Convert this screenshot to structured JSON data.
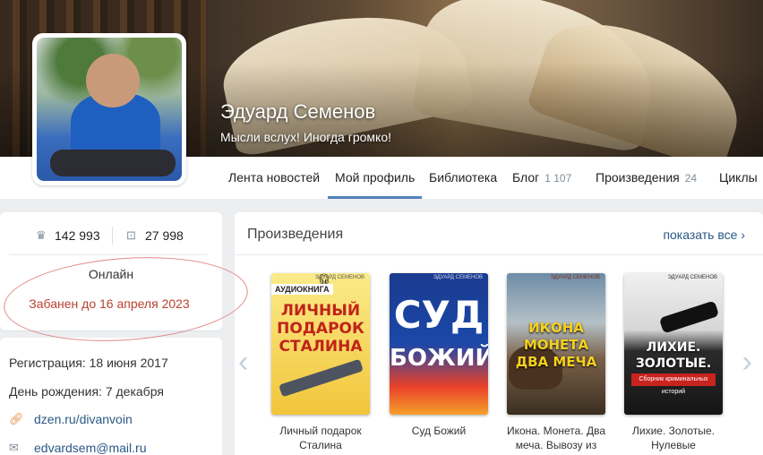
{
  "profile": {
    "name": "Эдуард Семенов",
    "motto": "Мысли вслух! Иногда громко!"
  },
  "nav": {
    "items": [
      {
        "label": "Лента новостей",
        "count": ""
      },
      {
        "label": "Мой профиль",
        "count": "",
        "active": true
      },
      {
        "label": "Библиотека",
        "count": ""
      },
      {
        "label": "Блог",
        "count": "1 107"
      },
      {
        "label": "Произведения",
        "count": "24"
      },
      {
        "label": "Циклы",
        "count": ""
      }
    ]
  },
  "stats": {
    "followers": "142 993",
    "library": "27 998",
    "status": "Онлайн",
    "ban": "Забанен до 16 апреля 2023"
  },
  "info": {
    "registration": "Регистрация: 18 июня 2017",
    "birthday": "День рождения: 7 декабря",
    "site": "dzen.ru/divanvoin",
    "email": "edvardsem@mail.ru"
  },
  "works": {
    "title": "Произведения",
    "show_all": "показать все",
    "books": [
      {
        "label": "Личный подарок Сталина",
        "cover_title": "ЛИЧНЫЙ ПОДАРОК СТАЛИНА",
        "badge": "АУДИОКНИГА"
      },
      {
        "label": "Суд Божий",
        "cover_title_1": "СУД",
        "cover_title_2": "БОЖИЙ"
      },
      {
        "label": "Икона. Монета. Два меча. Вывозу из",
        "cover_title": "ИКОНА МОНЕТА ДВА МЕЧА"
      },
      {
        "label": "Лихие. Золотые. Нулевые",
        "cover_title": "ЛИХИЕ. ЗОЛОТЫЕ. НУЛЕВЫЕ.",
        "cover_sub": "Сборник криминальных историй"
      }
    ],
    "cover_author": "ЭДУАРД СЕМЕНОВ"
  },
  "colors": {
    "accent": "#5181b8",
    "link": "#2a5885",
    "ban_text": "#b8412f"
  }
}
